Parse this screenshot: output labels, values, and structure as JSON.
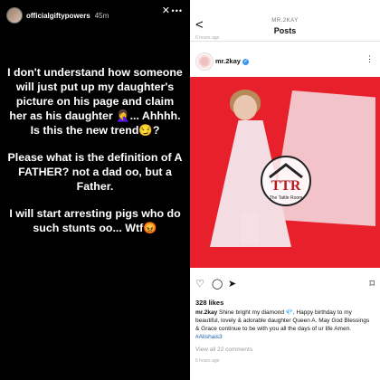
{
  "story": {
    "username": "officialgiftypowers",
    "time": "45m",
    "more": "•••",
    "close": "✕",
    "paragraphs": [
      "I don't understand how someone will just put up my daughter's picture on his page and claim her as his daughter 🤦‍♀️... Ahhhh. Is this the new trend😏?",
      "Please what is the definition of A FATHER? not a dad oo, but a Father.",
      "I will start arresting pigs who do such stunts oo... Wtf😡"
    ]
  },
  "post": {
    "back": "<",
    "account_label": "MR.2KAY",
    "title": "Posts",
    "prev_meta": "6 hours ago",
    "username": "mr.2kay",
    "verified": "✓",
    "more": "⋮",
    "watermark": "The Tattle Room",
    "likes": "328 likes",
    "caption_user": "mr.2kay",
    "caption_text": "Shine bright my diamond 💎, Happy birthday to my beautiful, lovely & adorable daughter Queen A. May God Blessings & Grace continue to be with you all the days of ur life Amen.",
    "caption_tag": "#Alishais3",
    "view_comments": "View all 22 comments",
    "time_ago": "6 hours ago",
    "icons": {
      "like": "heart-icon",
      "comment": "comment-icon",
      "share": "share-icon",
      "save": "bookmark-icon"
    }
  }
}
